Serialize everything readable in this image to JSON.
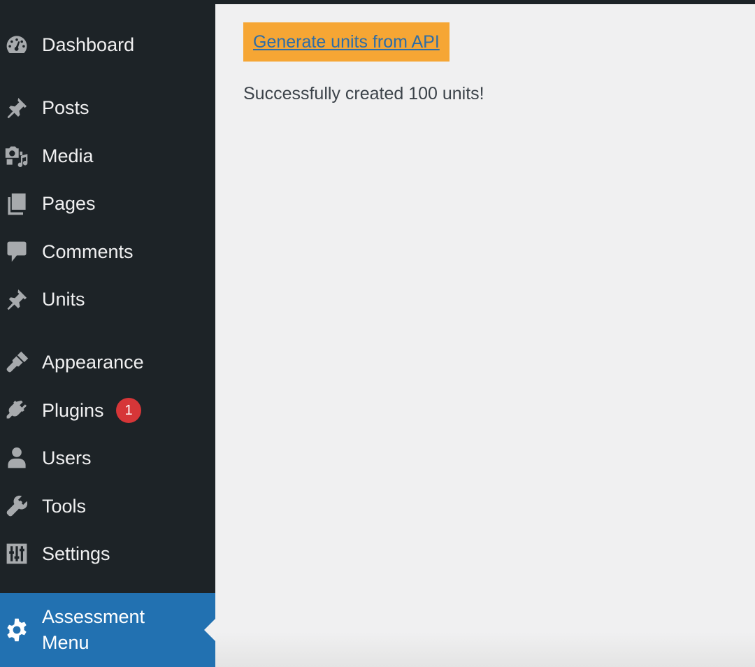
{
  "sidebar": {
    "items": [
      {
        "label": "Dashboard",
        "icon": "dashboard-icon"
      },
      {
        "label": "Posts",
        "icon": "pin-icon"
      },
      {
        "label": "Media",
        "icon": "media-icon"
      },
      {
        "label": "Pages",
        "icon": "pages-icon"
      },
      {
        "label": "Comments",
        "icon": "comment-icon"
      },
      {
        "label": "Units",
        "icon": "pin-icon"
      },
      {
        "label": "Appearance",
        "icon": "paintbrush-icon"
      },
      {
        "label": "Plugins",
        "icon": "plug-icon",
        "badge": "1"
      },
      {
        "label": "Users",
        "icon": "user-icon"
      },
      {
        "label": "Tools",
        "icon": "wrench-icon"
      },
      {
        "label": "Settings",
        "icon": "sliders-icon"
      },
      {
        "label": "Assessment Menu",
        "icon": "gear-icon",
        "current": true
      }
    ]
  },
  "main": {
    "generate_button_label": "Generate units from API",
    "status_message": "Successfully created 100 units!"
  },
  "colors": {
    "sidebar_bg": "#1d2327",
    "sidebar_text": "#f0f0f1",
    "sidebar_icon": "#a7aaad",
    "current_bg": "#2271b1",
    "badge_bg": "#d63638",
    "button_bg": "#f6a634",
    "button_text": "#2f6da6",
    "content_bg": "#f0f0f1"
  }
}
